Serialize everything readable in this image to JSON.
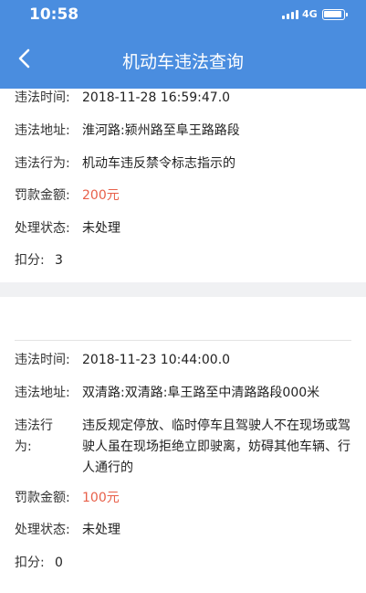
{
  "status_bar": {
    "time": "10:58",
    "network": "4G"
  },
  "nav": {
    "title": "机动车违法查询",
    "back_icon": "chevron-left-icon"
  },
  "colors": {
    "header": "#4a8ddf",
    "fine": "#e8604a",
    "divider": "#f0f1f3"
  },
  "records": [
    {
      "time_label": "违法时间:",
      "time": "2018-11-28 16:59:47.0",
      "location_label": "违法地址:",
      "location": "淮河路:颍州路至阜王路路段",
      "behavior_label": "违法行为:",
      "behavior": "机动车违反禁令标志指示的",
      "fine_label": "罚款金额:",
      "fine": "200元",
      "status_label": "处理状态:",
      "status": "未处理",
      "points_label": "扣分:",
      "points": "3"
    },
    {
      "time_label": "违法时间:",
      "time": "2018-11-23 10:44:00.0",
      "location_label": "违法地址:",
      "location": "双清路:双清路:阜王路至中清路路段000米",
      "behavior_label": "违法行为:",
      "behavior": "违反规定停放、临时停车且驾驶人不在现场或驾驶人虽在现场拒绝立即驶离，妨碍其他车辆、行人通行的",
      "fine_label": "罚款金额:",
      "fine": "100元",
      "status_label": "处理状态:",
      "status": "未处理",
      "points_label": "扣分:",
      "points": "0"
    }
  ]
}
